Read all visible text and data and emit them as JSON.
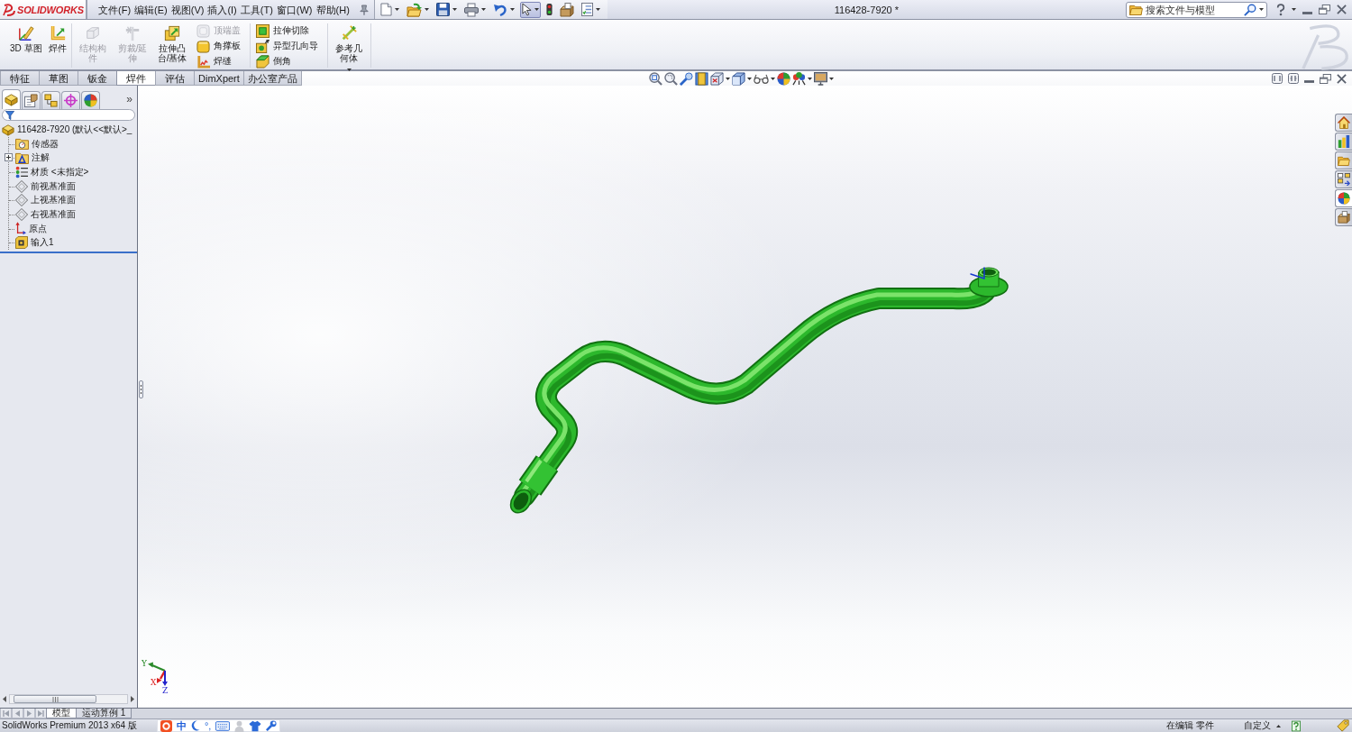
{
  "title_bar": {
    "logo_text": "SOLIDWORKS",
    "menu": [
      "文件(F)",
      "编辑(E)",
      "视图(V)",
      "插入(I)",
      "工具(T)",
      "窗口(W)",
      "帮助(H)"
    ],
    "quick_access": [
      {
        "dropdown": true,
        "selected": false
      },
      {
        "dropdown": true,
        "selected": false
      },
      {
        "dropdown": true,
        "selected": false
      },
      {
        "dropdown": true,
        "selected": false
      },
      {
        "dropdown": true,
        "selected": false
      },
      {
        "dropdown": true,
        "selected": true
      },
      {
        "dropdown": false,
        "selected": false
      },
      {
        "dropdown": false,
        "selected": false
      },
      {
        "dropdown": true,
        "selected": false
      }
    ],
    "document_title": "116428-7920 *",
    "search": {
      "placeholder": "搜索文件与模型"
    }
  },
  "ribbon": {
    "groups": [
      [
        {
          "kind": "large",
          "label": "3D 草图",
          "disabled": false
        },
        {
          "kind": "large",
          "label": "焊件",
          "disabled": false
        }
      ],
      [
        {
          "kind": "large",
          "label": "结构构件",
          "disabled": true
        },
        {
          "kind": "large",
          "label": "剪裁/延伸",
          "disabled": true
        },
        {
          "kind": "large",
          "label": "拉伸凸台/基体",
          "disabled": false
        },
        {
          "kind": "stack",
          "items": [
            {
              "label": "顶端盖",
              "disabled": true
            },
            {
              "label": "角撑板",
              "disabled": false
            },
            {
              "label": "焊缝",
              "disabled": false
            }
          ]
        }
      ],
      [
        {
          "kind": "stack",
          "items": [
            {
              "label": "拉伸切除",
              "disabled": false
            },
            {
              "label": "异型孔向导",
              "disabled": false
            },
            {
              "label": "倒角",
              "disabled": false
            }
          ]
        }
      ],
      [
        {
          "kind": "large",
          "label": "参考几何体",
          "disabled": false,
          "dropdown": true
        }
      ]
    ]
  },
  "command_tabs": [
    {
      "label": "特征",
      "selected": false
    },
    {
      "label": "草图",
      "selected": false
    },
    {
      "label": "钣金",
      "selected": false
    },
    {
      "label": "焊件",
      "selected": true
    },
    {
      "label": "评估",
      "selected": false
    },
    {
      "label": "DimXpert",
      "selected": false
    },
    {
      "label": "办公室产品",
      "selected": false
    }
  ],
  "view_toolbar": [
    {
      "dropdown": false
    },
    {
      "dropdown": false
    },
    {
      "dropdown": false
    },
    {
      "dropdown": false
    },
    {
      "dropdown": true
    },
    {
      "dropdown": true
    },
    {
      "dropdown": true
    },
    {
      "dropdown": false
    },
    {
      "dropdown": true
    },
    {
      "dropdown": true
    }
  ],
  "feature_manager": {
    "tabs": [
      {
        "selected": true
      },
      {
        "selected": false
      },
      {
        "selected": false
      },
      {
        "selected": false
      },
      {
        "selected": false
      }
    ],
    "more": "»",
    "tree": {
      "label": "116428-7920 (默认<<默认>_",
      "children": [
        {
          "label": "传感器",
          "expandable": false
        },
        {
          "label": "注解",
          "expandable": true
        },
        {
          "label": "材质 <未指定>",
          "expandable": false
        },
        {
          "label": "前视基准面",
          "expandable": false
        },
        {
          "label": "上视基准面",
          "expandable": false
        },
        {
          "label": "右视基准面",
          "expandable": false
        },
        {
          "label": "原点",
          "expandable": false
        },
        {
          "label": "输入1",
          "expandable": false
        }
      ]
    }
  },
  "viewport": {
    "triad": {
      "y": "Y",
      "x": "X",
      "z": "Z"
    },
    "task_pane": [
      {
        "selected": false
      },
      {
        "selected": false
      },
      {
        "selected": false
      },
      {
        "selected": false
      },
      {
        "selected": true
      },
      {
        "selected": false
      }
    ]
  },
  "bottom_tabs": [
    {
      "label": "模型",
      "selected": true
    },
    {
      "label": "运动算例 1",
      "selected": false
    }
  ],
  "status_bar": {
    "product": "SolidWorks Premium 2013 x64 版",
    "ime": {
      "mode": "中",
      "punctuation": "°,"
    },
    "edit_state": "在编辑 零件",
    "units": "自定义"
  }
}
